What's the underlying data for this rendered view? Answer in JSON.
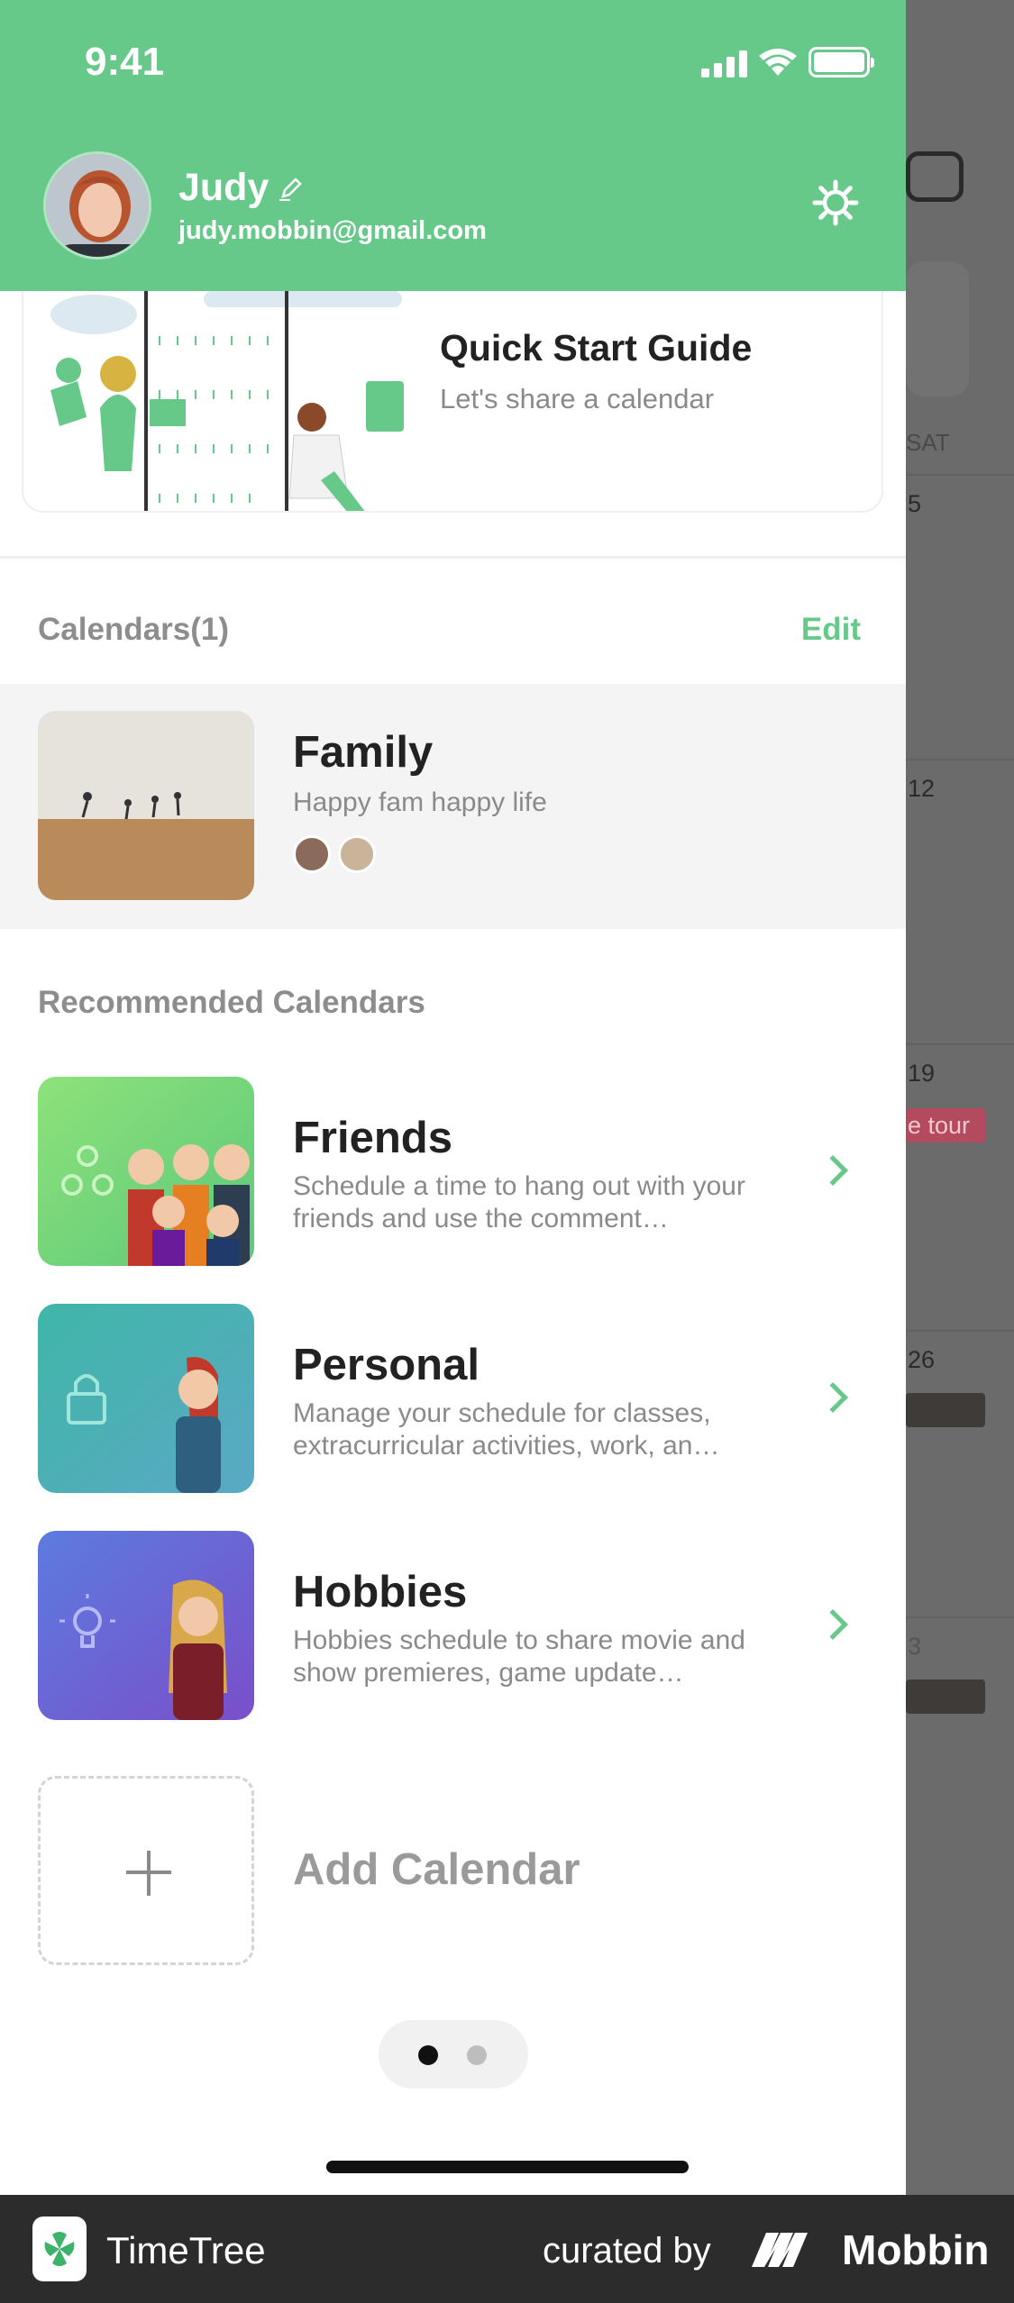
{
  "status_bar": {
    "time": "9:41"
  },
  "user": {
    "name": "Judy",
    "email": "judy.mobbin@gmail.com"
  },
  "quick_start": {
    "title": "Quick Start Guide",
    "subtitle": "Let's share a calendar"
  },
  "calendars": {
    "heading": "Calendars(1)",
    "edit_label": "Edit",
    "items": [
      {
        "title": "Family",
        "description": "Happy fam happy life"
      }
    ]
  },
  "recommended": {
    "heading": "Recommended Calendars",
    "items": [
      {
        "title": "Friends",
        "description": "Schedule a time to hang out with your friends and use the comment…"
      },
      {
        "title": "Personal",
        "description": "Manage your schedule for classes, extracurricular activities, work, an…"
      },
      {
        "title": "Hobbies",
        "description": "Hobbies schedule to share movie and show premieres, game update…"
      }
    ]
  },
  "add_calendar": {
    "label": "Add Calendar"
  },
  "pager": {
    "total": 2,
    "active": 1
  },
  "background_calendar": {
    "weekday": "SAT",
    "dates": [
      "5",
      "12",
      "19",
      "26",
      "3"
    ],
    "event_text": "e tour"
  },
  "footer": {
    "brand": "TimeTree",
    "curated_by": "curated by",
    "curator": "Mobbin"
  },
  "colors": {
    "accent": "#66c98a",
    "footer_bg": "#2c2c2c"
  }
}
